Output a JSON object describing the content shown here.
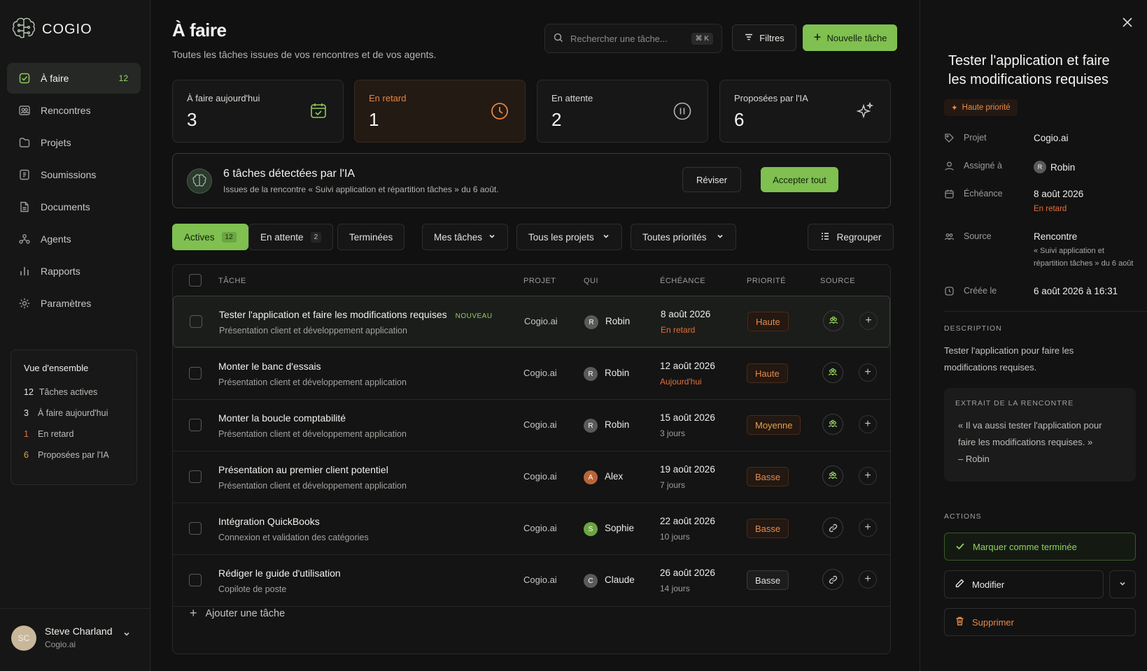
{
  "app": {
    "name": "COGIO"
  },
  "sidebar": {
    "items": [
      {
        "label": "À faire",
        "count": "12",
        "icon": "checklist-icon"
      },
      {
        "label": "Rencontres",
        "icon": "people-icon"
      },
      {
        "label": "Projets",
        "icon": "folder-icon"
      },
      {
        "label": "Soumissions",
        "icon": "doc-dollar-icon"
      },
      {
        "label": "Documents",
        "icon": "document-icon"
      },
      {
        "label": "Agents",
        "icon": "agents-icon"
      },
      {
        "label": "Rapports",
        "icon": "bar-chart-icon"
      },
      {
        "label": "Paramètres",
        "icon": "gear-icon"
      }
    ],
    "overview": {
      "title": "Vue d'ensemble",
      "rows": [
        {
          "n": "12",
          "label": "Tâches actives"
        },
        {
          "n": "3",
          "label": "À faire aujourd'hui"
        },
        {
          "n": "1",
          "label": "En retard"
        },
        {
          "n": "6",
          "label": "Proposées par l'IA"
        }
      ]
    },
    "user": {
      "initials": "SC",
      "name": "Steve Charland",
      "org": "Cogio.ai"
    }
  },
  "header": {
    "title": "À faire",
    "subtitle": "Toutes les tâches issues de vos rencontres et de vos agents.",
    "search_placeholder": "Rechercher une tâche...",
    "shortcut": "⌘ K",
    "filters_label": "Filtres",
    "new_task_label": "Nouvelle tâche"
  },
  "stats": [
    {
      "label": "À faire aujourd'hui",
      "value": "3",
      "icon": "calendar-icon"
    },
    {
      "label": "En retard",
      "value": "1",
      "icon": "clock-icon"
    },
    {
      "label": "En attente",
      "value": "2",
      "icon": "pause-icon"
    },
    {
      "label": "Proposées par l'IA",
      "value": "6",
      "icon": "sparkle-icon"
    }
  ],
  "ai_banner": {
    "title": "6 tâches détectées par l'IA",
    "subtitle": "Issues de la rencontre « Suivi application et répartition tâches » du 6 août.",
    "review_label": "Réviser",
    "accept_label": "Accepter tout"
  },
  "tabs": [
    {
      "label": "Actives",
      "count": "12"
    },
    {
      "label": "En attente",
      "count": "2"
    },
    {
      "label": "Terminées"
    }
  ],
  "dropdowns": {
    "mine": "Mes tâches",
    "projects": "Tous les projets",
    "priorities": "Toutes priorités",
    "group": "Regrouper"
  },
  "table": {
    "headers": [
      "TÂCHE",
      "PROJET",
      "QUI",
      "ÉCHÉANCE",
      "PRIORITÉ",
      "SOURCE"
    ],
    "rows": [
      {
        "title": "Tester l'application et faire les modifications requises",
        "new": "NOUVEAU",
        "sub": "Présentation client et développement application",
        "project": "Cogio.ai",
        "avatar": "R",
        "who": "Robin",
        "date": "8 août 2026",
        "dsub": "En retard",
        "priority": "Haute",
        "source": "people-icon"
      },
      {
        "title": "Monter le banc d'essais",
        "sub": "Présentation client et développement application",
        "project": "Cogio.ai",
        "avatar": "R",
        "who": "Robin",
        "date": "12 août 2026",
        "dsub": "Aujourd'hui",
        "priority": "Haute",
        "source": "people-icon"
      },
      {
        "title": "Monter la boucle comptabilité",
        "sub": "Présentation client et développement application",
        "project": "Cogio.ai",
        "avatar": "R",
        "who": "Robin",
        "date": "15 août 2026",
        "dsub": "3 jours",
        "priority": "Moyenne",
        "source": "people-icon"
      },
      {
        "title": "Présentation au premier client potentiel",
        "sub": "Présentation client et développement application",
        "project": "Cogio.ai",
        "avatar": "A",
        "who": "Alex",
        "date": "19 août 2026",
        "dsub": "7 jours",
        "priority": "Basse",
        "source": "people-icon"
      },
      {
        "title": "Intégration QuickBooks",
        "sub": "Connexion et validation des catégories",
        "project": "Cogio.ai",
        "avatar": "S",
        "who": "Sophie",
        "date": "22 août 2026",
        "dsub": "10 jours",
        "priority": "Basse",
        "source": "link-icon"
      },
      {
        "title": "Rédiger le guide d'utilisation",
        "sub": "Copilote de poste",
        "project": "Cogio.ai",
        "avatar": "C",
        "who": "Claude",
        "date": "26 août 2026",
        "dsub": "14 jours",
        "priority": "Basse",
        "source": "link-icon"
      }
    ],
    "add_label": "Ajouter une tâche"
  },
  "panel": {
    "title": "Tester l'application et faire les modifications requises",
    "priority": "Haute priorité",
    "project_key": "Projet",
    "project_val": "Cogio.ai",
    "assigned_key": "Assigné à",
    "assigned_val": "Robin",
    "assigned_initial": "R",
    "due_key": "Échéance",
    "due_val": "8 août 2026",
    "due_sub": "En retard",
    "source_key": "Source",
    "source_val": "Rencontre",
    "source_sub1": "« Suivi application et",
    "source_sub2": "répartition tâches » du 6 août",
    "created_key": "Créée le",
    "created_val": "6 août 2026 à 16:31",
    "desc_label": "DESCRIPTION",
    "desc": "Tester l'application pour faire les modifications requises.",
    "extract_label": "EXTRAIT DE LA RENCONTRE",
    "quote1": "« Il va aussi tester l'application pour",
    "quote2": "faire les modifications requises. »",
    "quote3": "– Robin",
    "actions_label": "ACTIONS",
    "done_label": "Marquer comme terminée",
    "edit_label": "Modifier",
    "delete_label": "Supprimer"
  },
  "colors": {
    "accent": "#7fc050",
    "late": "#e58a4a",
    "background": "#111111"
  }
}
